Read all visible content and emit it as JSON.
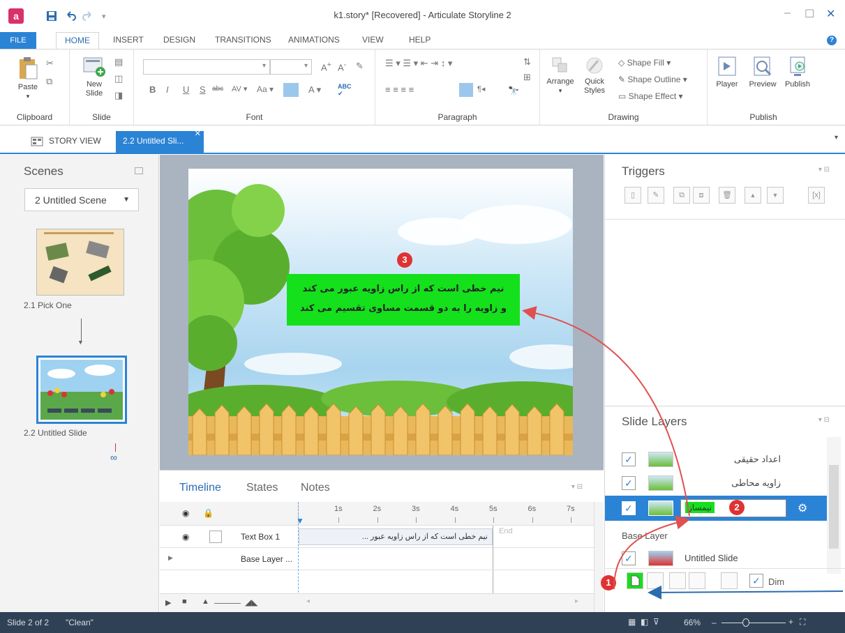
{
  "window": {
    "title": "k1.story* [Recovered] - Articulate Storyline 2"
  },
  "menu": {
    "tabs": [
      "FILE",
      "HOME",
      "INSERT",
      "DESIGN",
      "TRANSITIONS",
      "ANIMATIONS",
      "VIEW",
      "HELP"
    ]
  },
  "ribbon": {
    "clipboard": {
      "paste": "Paste",
      "label": "Clipboard"
    },
    "slide": {
      "new_slide": "New Slide",
      "label": "Slide"
    },
    "font": {
      "label": "Font",
      "aa": "Aa"
    },
    "paragraph": {
      "label": "Paragraph"
    },
    "drawing": {
      "arrange": "Arrange",
      "quick_styles": "Quick Styles",
      "shape_fill": "Shape Fill",
      "shape_outline": "Shape Outline",
      "shape_effect": "Shape Effect",
      "label": "Drawing"
    },
    "publish": {
      "player": "Player",
      "preview": "Preview",
      "publish": "Publish",
      "label": "Publish"
    }
  },
  "doc_tabs": {
    "story_view": "STORY VIEW",
    "active": "2.2 Untitled Sli..."
  },
  "scenes": {
    "title": "Scenes",
    "selected_scene": "2 Untitled Scene",
    "slides": [
      {
        "caption": "2.1 Pick One"
      },
      {
        "caption": "2.2 Untitled Slide"
      }
    ]
  },
  "slide": {
    "textbox_line1": "نیم خطی است که از راس زاویه عبور می کند",
    "textbox_line2": "و زاویه را به دو قسمت مساوی تقسیم می کند"
  },
  "timeline": {
    "tabs": [
      "Timeline",
      "States",
      "Notes"
    ],
    "ticks": [
      "1s",
      "2s",
      "3s",
      "4s",
      "5s",
      "6s",
      "7s"
    ],
    "rows": [
      {
        "name": "Text Box 1",
        "bar_text": "نیم خطی است که از راس زاویه عبور ...",
        "end_label": "End"
      },
      {
        "name": "Base Layer ..."
      }
    ]
  },
  "triggers": {
    "title": "Triggers"
  },
  "layers": {
    "title": "Slide Layers",
    "items": [
      {
        "name": "اعداد حقیقی"
      },
      {
        "name": "زاویه محاطی"
      },
      {
        "name": "نیمساز"
      }
    ],
    "base_label": "Base Layer",
    "base_item": "Untitled Slide",
    "dim_label": "Dim"
  },
  "annotations": {
    "badge1": "1",
    "badge2": "2",
    "badge3": "3"
  },
  "status": {
    "slide_info": "Slide 2 of 2",
    "theme": "\"Clean\"",
    "zoom": "66%"
  },
  "colors": {
    "accent": "#2b83d6",
    "status_bg": "#2f4155",
    "highlight_green": "#14e01c",
    "selected_layer": "#2b83d6",
    "badge": "#e03232"
  }
}
